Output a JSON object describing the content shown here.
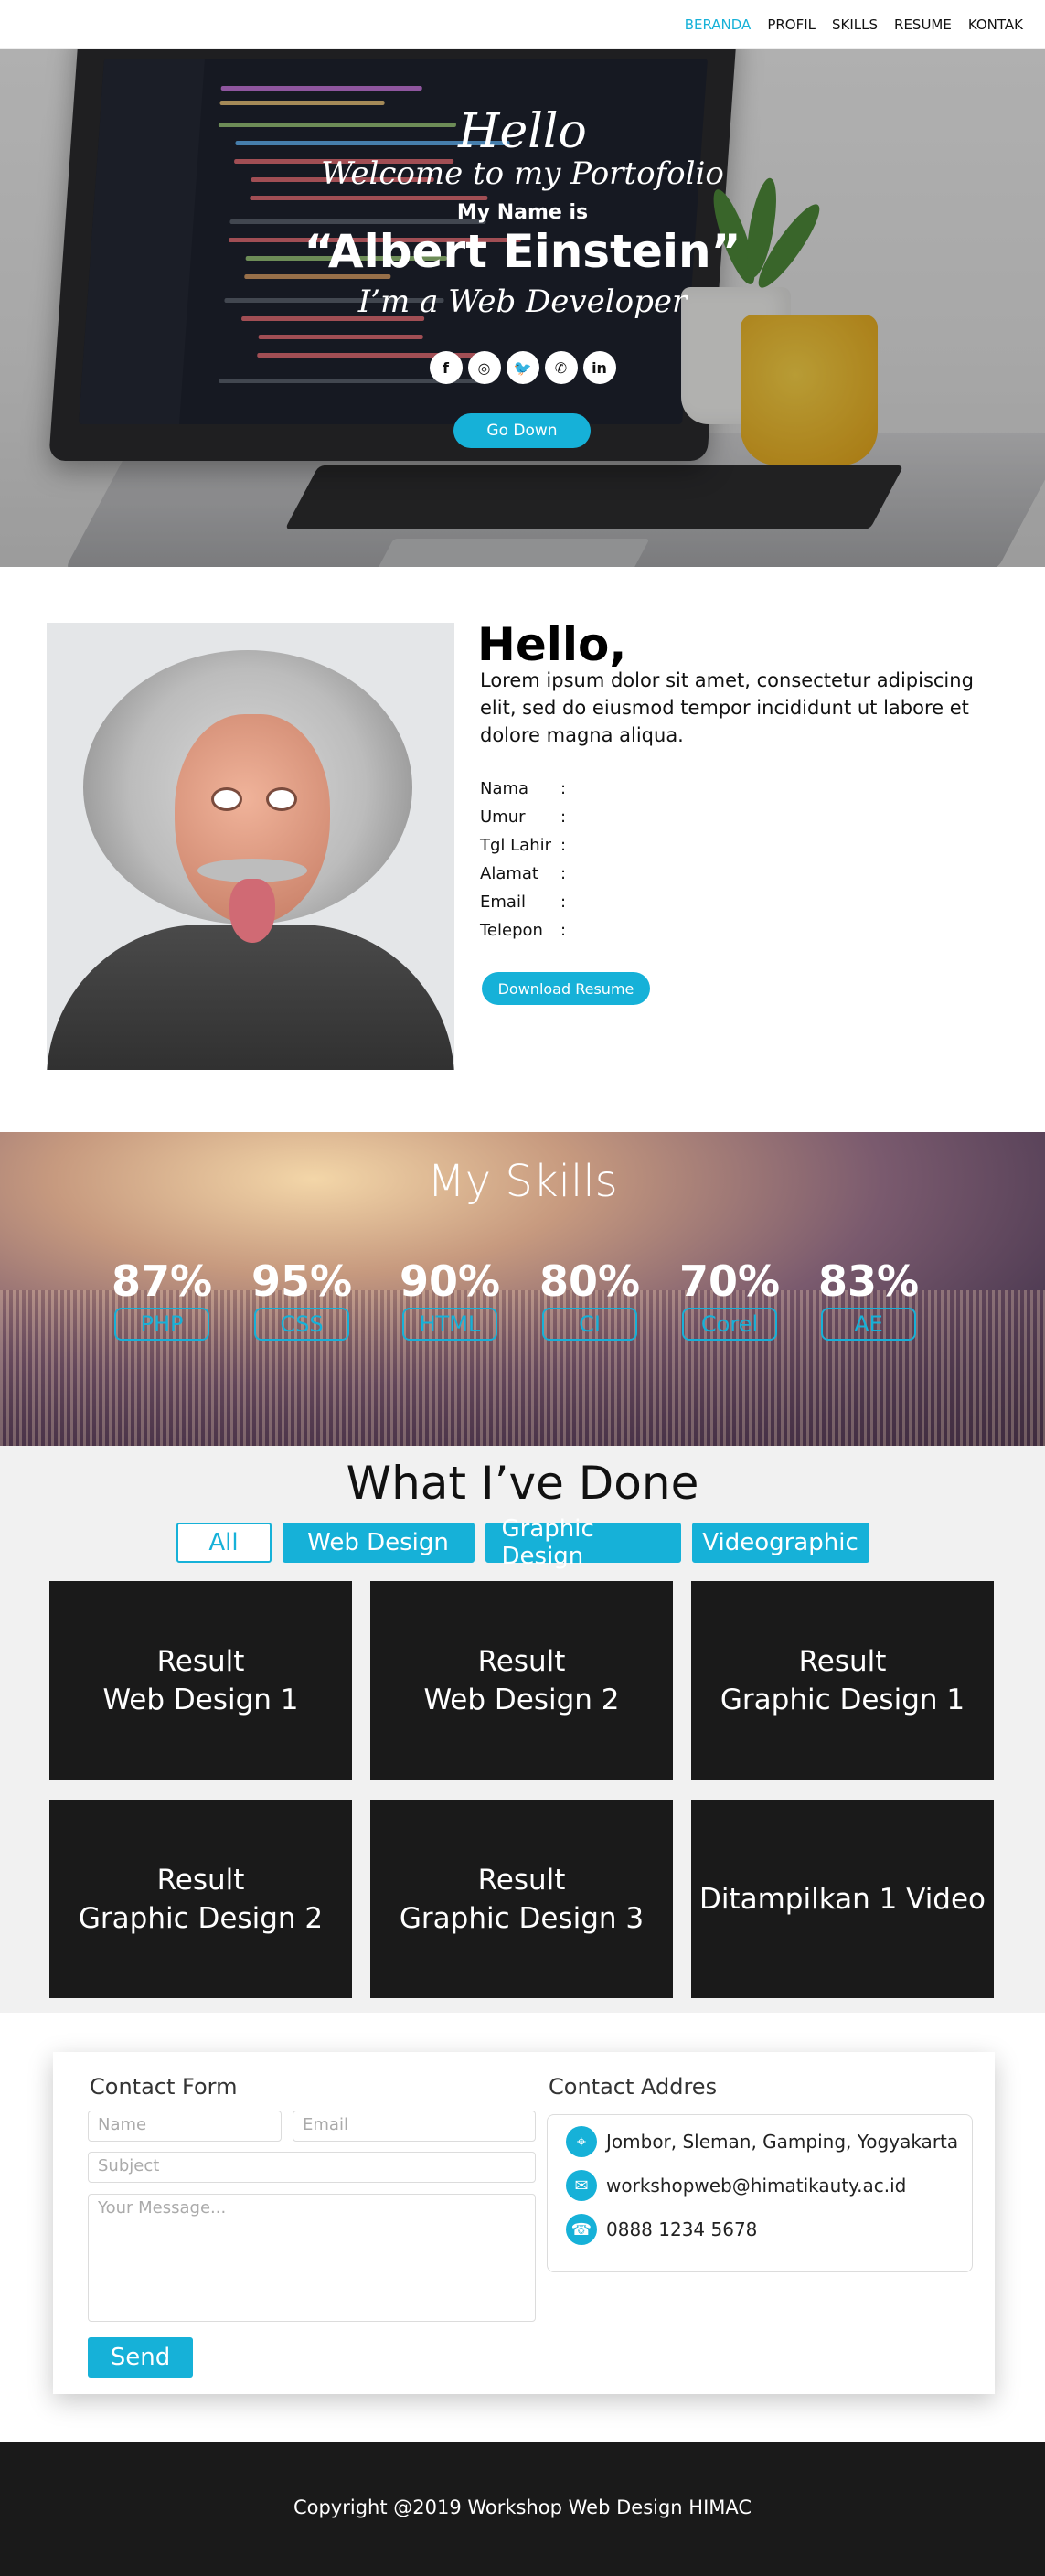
{
  "nav": {
    "items": [
      "BERANDA",
      "PROFIL",
      "SKILLS",
      "RESUME",
      "KONTAK"
    ],
    "active": "BERANDA"
  },
  "hero": {
    "hello": "Hello",
    "welcome": "Welcome to my Portofolio",
    "my_name_is": "My Name is",
    "name": "“Albert Einstein”",
    "role": "I’m a Web Developer",
    "socials": [
      {
        "icon": "facebook-icon",
        "glyph": "f"
      },
      {
        "icon": "instagram-icon",
        "glyph": "◎"
      },
      {
        "icon": "twitter-icon",
        "glyph": "🐦"
      },
      {
        "icon": "whatsapp-icon",
        "glyph": "✆"
      },
      {
        "icon": "linkedin-icon",
        "glyph": "in"
      }
    ],
    "go_down": "Go Down"
  },
  "profile": {
    "hello": "Hello,",
    "intro": "Lorem ipsum dolor sit amet, consectetur adipiscing elit, sed do eiusmod tempor incididunt ut labore et dolore magna aliqua.",
    "fields": [
      {
        "label": "Nama",
        "sep": ":"
      },
      {
        "label": "Umur",
        "sep": ":"
      },
      {
        "label": "Tgl Lahir",
        "sep": ":"
      },
      {
        "label": "Alamat",
        "sep": ":"
      },
      {
        "label": "Email",
        "sep": ":"
      },
      {
        "label": "Telepon",
        "sep": ":"
      }
    ],
    "download_button": "Download Resume"
  },
  "skills": {
    "title": "My Skills",
    "items": [
      {
        "percent": "87%",
        "name": "PHP"
      },
      {
        "percent": "95%",
        "name": "CSS"
      },
      {
        "percent": "90%",
        "name": "HTML"
      },
      {
        "percent": "80%",
        "name": "CI"
      },
      {
        "percent": "70%",
        "name": "Corel"
      },
      {
        "percent": "83%",
        "name": "AE"
      }
    ]
  },
  "portfolio": {
    "title": "What I’ve Done",
    "filters": [
      "All",
      "Web Design",
      "Graphic Design",
      "Videographic"
    ],
    "cards": [
      {
        "line1": "Result",
        "line2": "Web Design 1"
      },
      {
        "line1": "Result",
        "line2": "Web Design 2"
      },
      {
        "line1": "Result",
        "line2": "Graphic Design 1"
      },
      {
        "line1": "Result",
        "line2": "Graphic Design 2"
      },
      {
        "line1": "Result",
        "line2": "Graphic Design 3"
      },
      {
        "line1": "",
        "line2": "Ditampilkan 1 Video"
      }
    ]
  },
  "contact": {
    "form_title": "Contact Form",
    "name_placeholder": "Name",
    "email_placeholder": "Email",
    "subject_placeholder": "Subject",
    "message_placeholder": "Your Message...",
    "send": "Send",
    "address_title": "Contact Addres",
    "address": "Jombor, Sleman, Gamping, Yogyakarta",
    "email": "workshopweb@himatikauty.ac.id",
    "phone": "0888 1234 5678"
  },
  "footer": {
    "copyright": "Copyright @2019 Workshop Web Design HIMAC"
  },
  "colors": {
    "accent": "#16b1d8",
    "dark": "#1a1a1a",
    "portfolio_bg": "#f1f1f1"
  }
}
